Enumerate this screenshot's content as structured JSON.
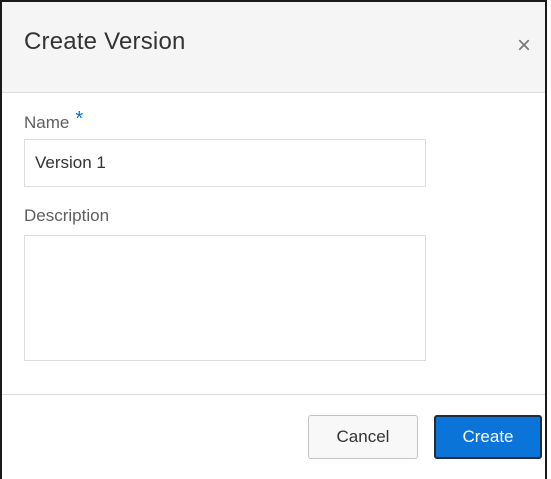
{
  "dialog": {
    "title": "Create Version",
    "close_glyph": "×",
    "close_icon": "close-icon"
  },
  "form": {
    "name_label": "Name",
    "required_marker": "*",
    "name_value": "Version 1",
    "description_label": "Description",
    "description_value": ""
  },
  "footer": {
    "cancel_label": "Cancel",
    "create_label": "Create"
  },
  "colors": {
    "primary": "#0b74d9",
    "required": "#0b6bc8",
    "header_bg": "#f5f5f5"
  }
}
